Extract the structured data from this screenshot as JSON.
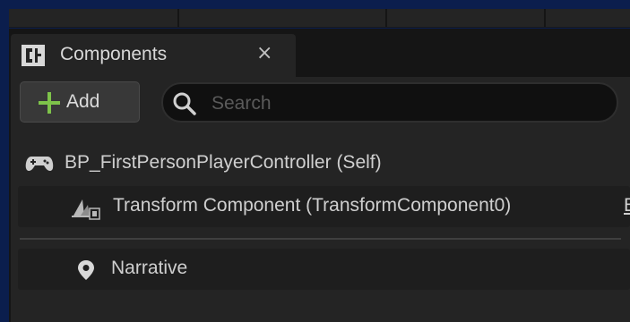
{
  "panel": {
    "tab_title": "Components",
    "close_glyph": "×",
    "tab_icon": "components-icon"
  },
  "toolbar": {
    "add_label": "Add",
    "add_icon": "plus-icon",
    "accent_color": "#7ec34a"
  },
  "search": {
    "placeholder": "Search",
    "value": ""
  },
  "tree": {
    "root": {
      "label": "BP_FirstPersonPlayerController (Self)",
      "icon": "gamepad-icon"
    },
    "items": [
      {
        "label": "Transform Component (TransformComponent0)",
        "icon": "transform-icon",
        "trailing": "E"
      },
      {
        "label": "Narrative",
        "icon": "location-pin-icon"
      }
    ]
  }
}
